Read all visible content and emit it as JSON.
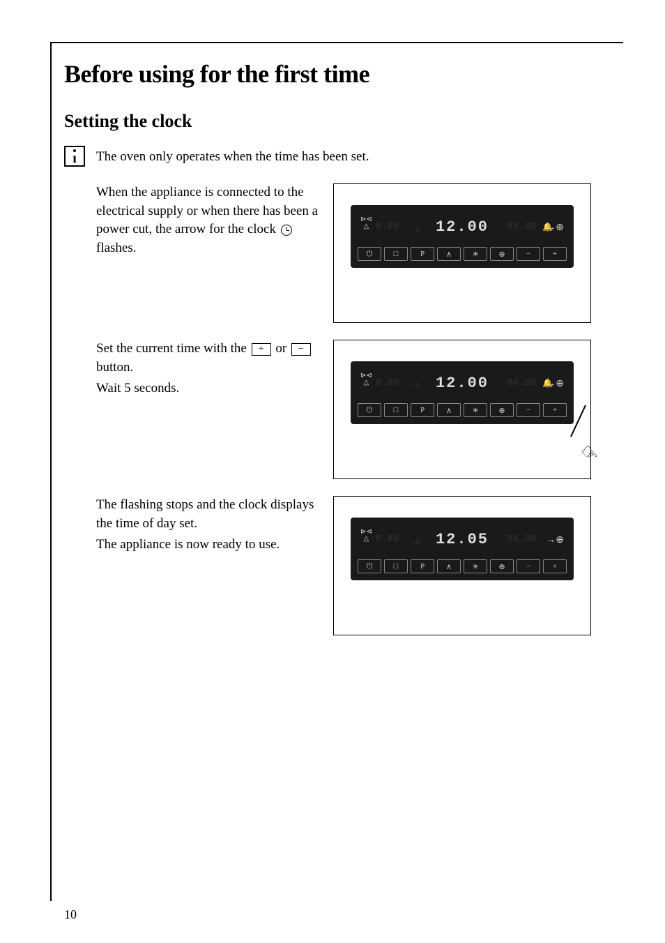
{
  "title": "Before using for the first time",
  "section": "Setting the clock",
  "info_note": "The oven only operates when the time has been set.",
  "step1_text": "When the appliance is connected to the electrical supply or when there has been a power cut, the arrow for the clock ",
  "step1_suffix": " flashes.",
  "step2_text_a": "Set the current time with the ",
  "step2_text_b": " or ",
  "step2_text_c": " button.",
  "step2_wait": "Wait 5 seconds.",
  "step3_text_a": "The flashing stops and the clock displays the time of day set.",
  "step3_text_b": "The appliance is now ready to use.",
  "display1_time": "12.00",
  "display2_time": "12.00",
  "display3_time": "12.05",
  "page_number": "10",
  "btn_plus": "+",
  "btn_minus": "−",
  "panel_btn_p": "P"
}
